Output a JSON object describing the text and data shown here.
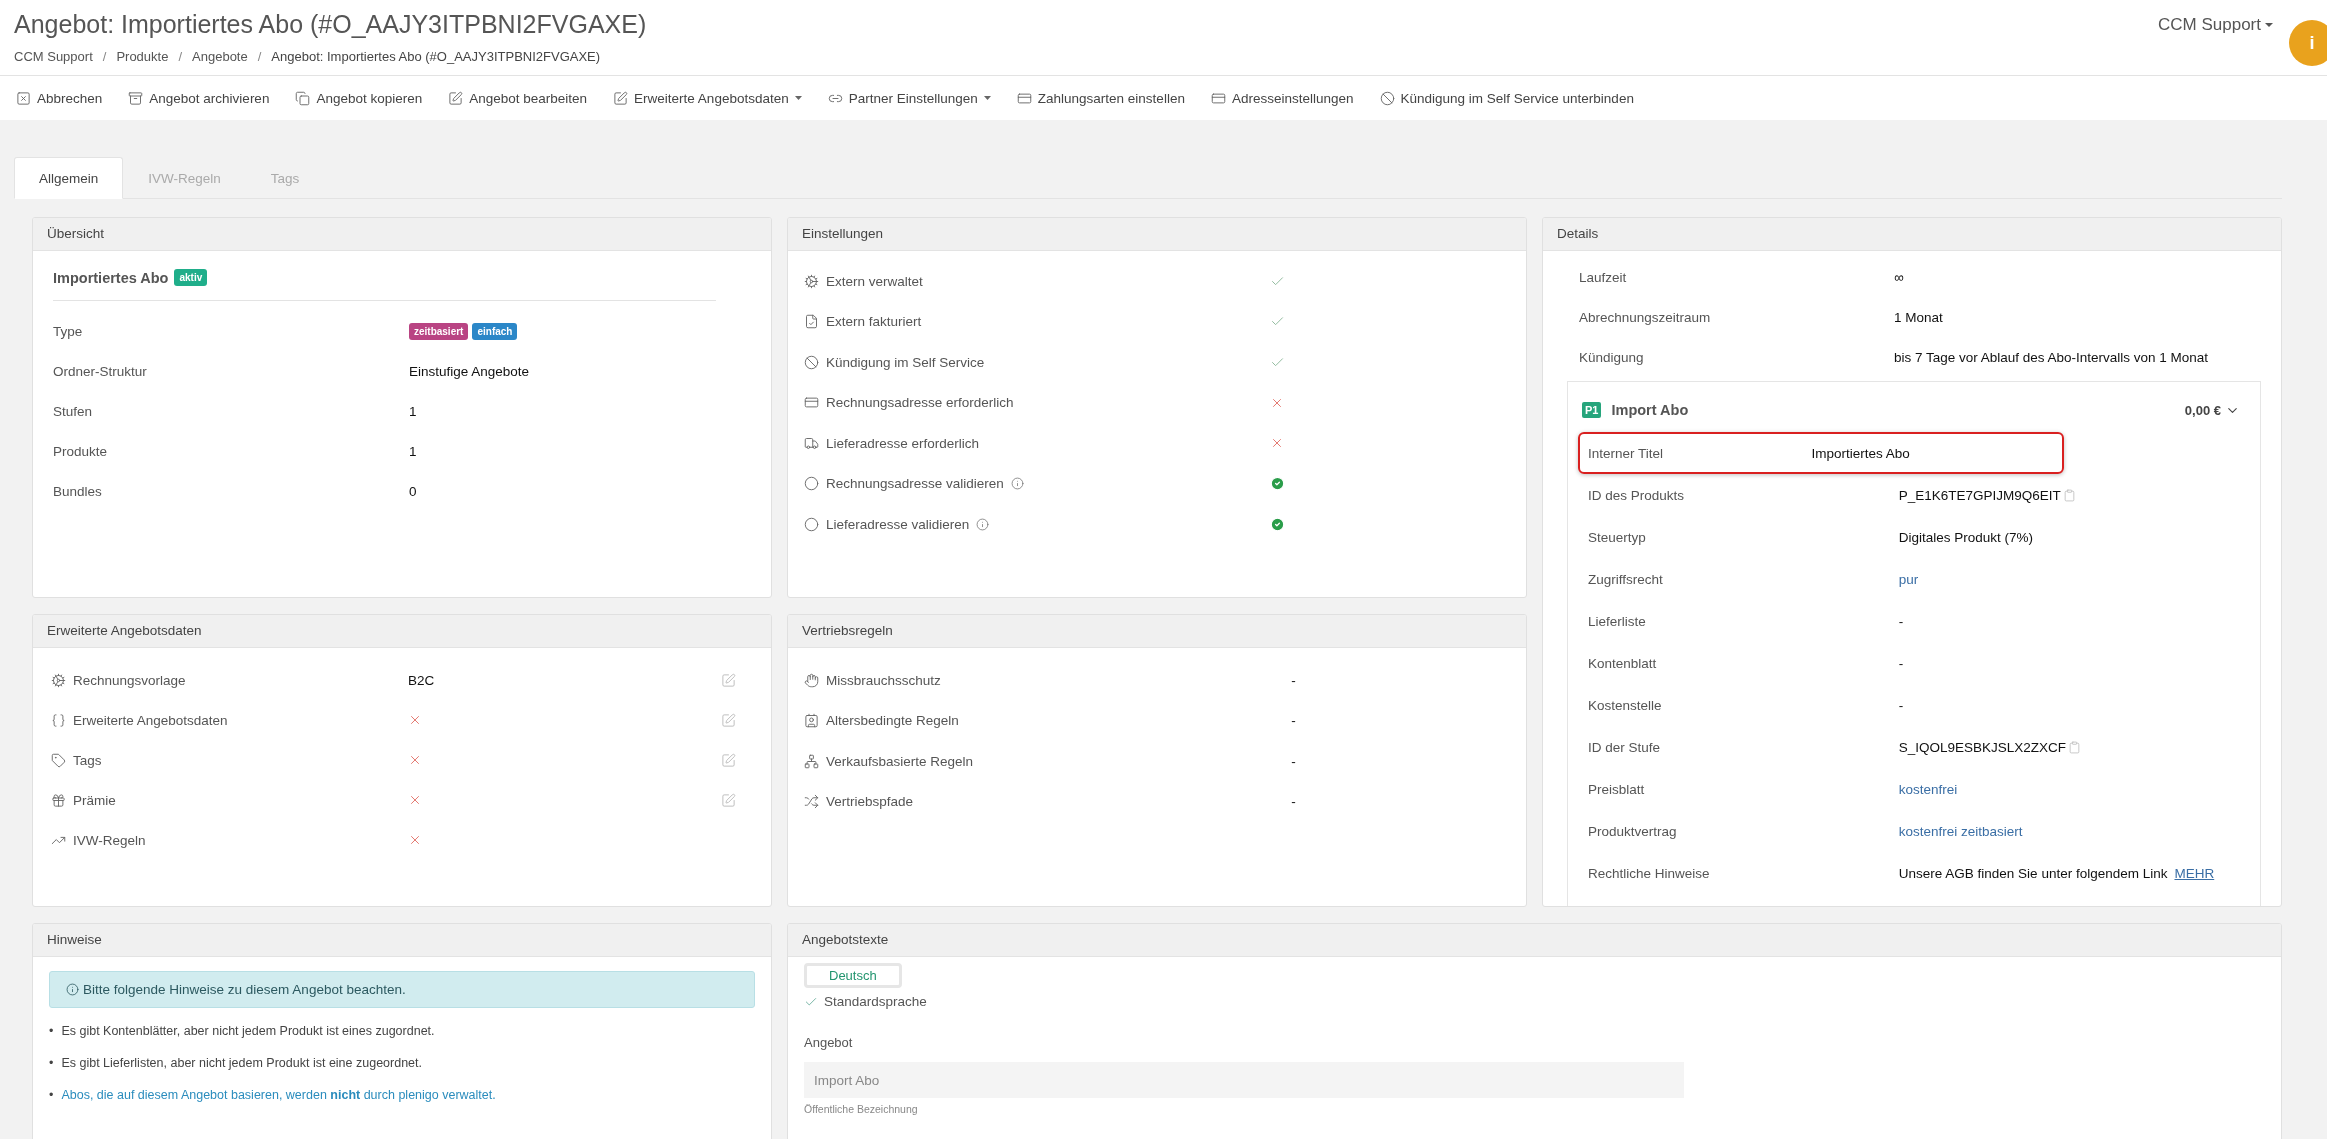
{
  "header": {
    "title": "Angebot: Importiertes Abo (#O_AAJY3ITPBNI2FVGAXE)",
    "breadcrumbs": [
      {
        "label": "CCM Support",
        "current": false
      },
      {
        "label": "Produkte",
        "current": false
      },
      {
        "label": "Angebote",
        "current": false
      },
      {
        "label": "Angebot: Importiertes Abo (#O_AAJY3ITPBNI2FVGAXE)",
        "current": true
      }
    ],
    "separator": "/",
    "user": "CCM Support",
    "info_badge": "i"
  },
  "toolbar": [
    {
      "label": "Abbrechen",
      "dropdown": false
    },
    {
      "label": "Angebot archivieren",
      "dropdown": false
    },
    {
      "label": "Angebot kopieren",
      "dropdown": false
    },
    {
      "label": "Angebot bearbeiten",
      "dropdown": false
    },
    {
      "label": "Erweiterte Angebotsdaten",
      "dropdown": true
    },
    {
      "label": "Partner Einstellungen",
      "dropdown": true
    },
    {
      "label": "Zahlungsarten einstellen",
      "dropdown": false
    },
    {
      "label": "Adresseinstellungen",
      "dropdown": false
    },
    {
      "label": "Kündigung im Self Service unterbinden",
      "dropdown": false
    }
  ],
  "tabs": [
    {
      "label": "Allgemein",
      "selected": true
    },
    {
      "label": "IVW-Regeln",
      "selected": false
    },
    {
      "label": "Tags",
      "selected": false
    }
  ],
  "overview": {
    "title": "Übersicht",
    "name": "Importiertes Abo",
    "status": "aktiv",
    "rows": [
      {
        "label": "Type",
        "kind": "badges",
        "badges": [
          {
            "label": "zeitbasiert",
            "color": "#b94483"
          },
          {
            "label": "einfach",
            "color": "#2b87c8"
          }
        ]
      },
      {
        "label": "Ordner-Struktur",
        "kind": "text",
        "value": "Einstufige Angebote"
      },
      {
        "label": "Stufen",
        "kind": "text",
        "value": "1"
      },
      {
        "label": "Produkte",
        "kind": "text",
        "value": "1"
      },
      {
        "label": "Bundles",
        "kind": "text",
        "value": "0"
      }
    ]
  },
  "settings": {
    "title": "Einstellungen",
    "rows": [
      {
        "label": "Extern verwaltet",
        "kind": "flag",
        "enabled": true,
        "info": false
      },
      {
        "label": "Extern fakturiert",
        "kind": "flag",
        "enabled": true,
        "info": false
      },
      {
        "label": "Kündigung im Self Service",
        "kind": "flag",
        "enabled": true,
        "info": false
      },
      {
        "label": "Rechnungsadresse erforderlich",
        "kind": "flag",
        "enabled": false,
        "info": false
      },
      {
        "label": "Lieferadresse erforderlich",
        "kind": "flag",
        "enabled": false,
        "info": false
      },
      {
        "label": "Rechnungsadresse validieren",
        "kind": "validation",
        "enabled": true,
        "info": true
      },
      {
        "label": "Lieferadresse validieren",
        "kind": "validation",
        "enabled": true,
        "info": true
      }
    ]
  },
  "extended": {
    "title": "Erweiterte Angebotsdaten",
    "rows": [
      {
        "label": "Rechnungsvorlage",
        "set": true,
        "value": "B2C",
        "editable": true
      },
      {
        "label": "Erweiterte Angebotsdaten",
        "set": false,
        "editable": true
      },
      {
        "label": "Tags",
        "set": false,
        "editable": true
      },
      {
        "label": "Prämie",
        "set": false,
        "editable": true
      },
      {
        "label": "IVW-Regeln",
        "set": false,
        "editable": false
      }
    ]
  },
  "sales_rules": {
    "title": "Vertriebsregeln",
    "rows": [
      {
        "label": "Missbrauchsschutz",
        "value": "-"
      },
      {
        "label": "Altersbedingte Regeln",
        "value": "-"
      },
      {
        "label": "Verkaufsbasierte Regeln",
        "value": "-"
      },
      {
        "label": "Vertriebspfade",
        "value": "-"
      }
    ]
  },
  "details": {
    "title": "Details",
    "rows": [
      {
        "label": "Laufzeit",
        "value": "∞"
      },
      {
        "label": "Abrechnungszeitraum",
        "value": "1 Monat"
      },
      {
        "label": "Kündigung",
        "value": "bis 7 Tage vor Ablauf des Abo-Intervalls von 1 Monat"
      }
    ],
    "product": {
      "badge": "P1",
      "name": "Import Abo",
      "price": "0,00 €",
      "rows": [
        {
          "label": "Interner Titel",
          "kind": "text",
          "value": "Importiertes Abo",
          "highlighted": true
        },
        {
          "label": "ID des Produkts",
          "kind": "copy",
          "value": "P_E1K6TE7GPIJM9Q6EIT",
          "highlighted": false
        },
        {
          "label": "Steuertyp",
          "kind": "text",
          "value": "Digitales Produkt (7%)",
          "highlighted": false
        },
        {
          "label": "Zugriffsrecht",
          "kind": "link",
          "value": "pur",
          "highlighted": false
        },
        {
          "label": "Lieferliste",
          "kind": "text",
          "value": "-",
          "highlighted": false
        },
        {
          "label": "Kontenblatt",
          "kind": "text",
          "value": "-",
          "highlighted": false
        },
        {
          "label": "Kostenstelle",
          "kind": "text",
          "value": "-",
          "highlighted": false
        },
        {
          "label": "ID der Stufe",
          "kind": "copy",
          "value": "S_IQOL9ESBKJSLX2ZXCF",
          "highlighted": false
        },
        {
          "label": "Preisblatt",
          "kind": "link",
          "value": "kostenfrei",
          "highlighted": false
        },
        {
          "label": "Produktvertrag",
          "kind": "link",
          "value": "kostenfrei zeitbasiert",
          "highlighted": false
        },
        {
          "label": "Rechtliche Hinweise",
          "kind": "legal",
          "value": "Unsere AGB finden Sie unter folgendem Link",
          "link": "MEHR",
          "highlighted": false
        }
      ]
    }
  },
  "hints": {
    "title": "Hinweise",
    "bullet": "•",
    "alert": "Bitte folgende Hinweise zu diesem Angebot beachten.",
    "items": [
      {
        "kind": "note",
        "text": "Es gibt Kontenblätter, aber nicht jedem Produkt ist eines zugordnet."
      },
      {
        "kind": "note",
        "text": "Es gibt Lieferlisten, aber nicht jedem Produkt ist eine zugeordnet."
      },
      {
        "kind": "link",
        "text": "Abos, die auf diesem Angebot basieren, werden **nicht** durch plenigo verwaltet."
      }
    ]
  },
  "offer_texts": {
    "title": "Angebotstexte",
    "languages": [
      {
        "label": "Deutsch",
        "selected": true
      }
    ],
    "default_language": "Standardsprache",
    "field_label": "Angebot",
    "field_value": "Import Abo",
    "field_help": "Öffentliche Bezeichnung"
  }
}
